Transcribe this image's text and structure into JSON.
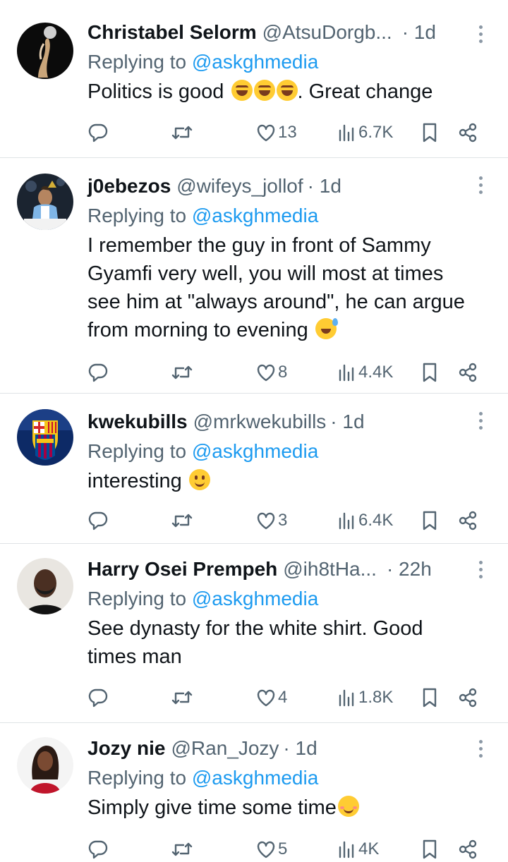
{
  "replying_label": "Replying to",
  "replies": [
    {
      "name": "Christabel Selorm",
      "handle": "@AtsuDorgb...",
      "time": "· 1d",
      "mention": "@askghmedia",
      "lines": [
        "Politics is good",
        ". Great change"
      ],
      "likes": "13",
      "views": "6.7K",
      "avatar_icon": "moon-avatar"
    },
    {
      "name": "j0ebezos",
      "handle": "@wifeys_jollof",
      "time": "· 1d",
      "mention": "@askghmedia",
      "lines": [
        "I remember the guy in front of Sammy",
        "Gyamfi very well, you will most at times",
        "see him at \"always around\", he can argue",
        "from morning to evening"
      ],
      "likes": "8",
      "views": "4.4K",
      "avatar_icon": "trophy-avatar"
    },
    {
      "name": "kwekubills",
      "handle": "@mrkwekubills",
      "time": "· 1d",
      "mention": "@askghmedia",
      "lines": [
        "interesting"
      ],
      "likes": "3",
      "views": "6.4K",
      "avatar_icon": "fcb-crest-avatar"
    },
    {
      "name": "Harry Osei Prempeh",
      "handle": "@ih8tHa...",
      "time": "· 22h",
      "mention": "@askghmedia",
      "lines": [
        "See dynasty for the white shirt. Good",
        "times man"
      ],
      "likes": "4",
      "views": "1.8K",
      "avatar_icon": "portrait-avatar"
    },
    {
      "name": "Jozy nie",
      "handle": "@Ran_Jozy",
      "time": "· 1d",
      "mention": "@askghmedia",
      "lines": [
        "Simply give time some time"
      ],
      "likes": "5",
      "views": "4K",
      "avatar_icon": "portrait-avatar-red"
    }
  ],
  "colors": {
    "text": "#0f1419",
    "secondary": "#536471",
    "link": "#1d9bf0",
    "divider": "#dfe3e6"
  },
  "icons": {
    "reply": "reply-icon",
    "retweet": "retweet-icon",
    "like": "heart-icon",
    "views": "views-icon",
    "bookmark": "bookmark-icon",
    "share": "share-icon",
    "more": "more-vertical-icon"
  }
}
